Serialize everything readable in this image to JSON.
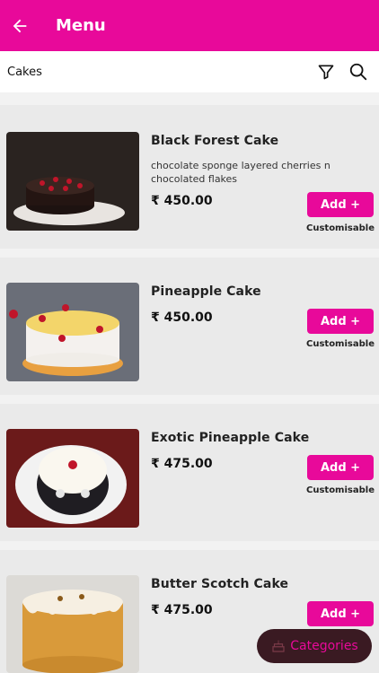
{
  "appbar": {
    "title": "Menu"
  },
  "subbar": {
    "title": "Cakes"
  },
  "colors": {
    "accent": "#e8099a",
    "categories_bg": "#3a1a22"
  },
  "items": [
    {
      "name": "Black Forest Cake",
      "description": "chocolate sponge layered cherries n chocolated flakes",
      "price": "₹ 450.00",
      "add_label": "Add +",
      "custom_label": "Customisable"
    },
    {
      "name": "Pineapple Cake",
      "description": "",
      "price": "₹ 450.00",
      "add_label": "Add +",
      "custom_label": "Customisable"
    },
    {
      "name": "Exotic Pineapple Cake",
      "description": "",
      "price": "₹ 475.00",
      "add_label": "Add +",
      "custom_label": "Customisable"
    },
    {
      "name": "Butter Scotch Cake",
      "description": "",
      "price": "₹ 475.00",
      "add_label": "Add +",
      "custom_label": ""
    }
  ],
  "categories_button": {
    "label": "Categories"
  }
}
